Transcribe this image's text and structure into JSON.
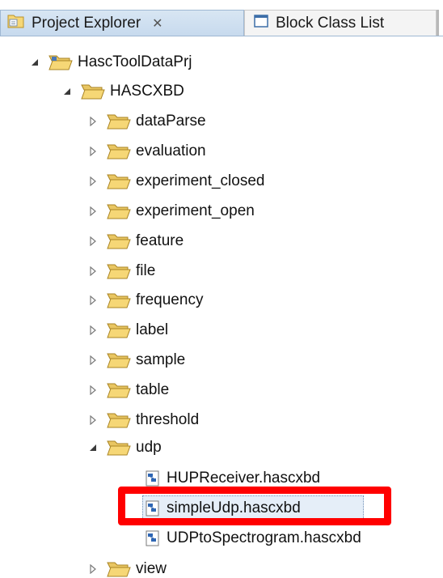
{
  "tabs": [
    {
      "label": "Project Explorer",
      "close_glyph": "✕",
      "icon": "project-explorer-icon",
      "active": true
    },
    {
      "label": "Block Class List",
      "icon": "block-class-list-icon",
      "active": false
    }
  ],
  "tree": {
    "root": {
      "label": "HascToolDataPrj",
      "expanded": true
    },
    "project_folder": {
      "label": "HASCXBD",
      "expanded": true
    },
    "folders": [
      {
        "label": "dataParse"
      },
      {
        "label": "evaluation"
      },
      {
        "label": "experiment_closed"
      },
      {
        "label": "experiment_open"
      },
      {
        "label": "feature"
      },
      {
        "label": "file"
      },
      {
        "label": "frequency"
      },
      {
        "label": "label"
      },
      {
        "label": "sample"
      },
      {
        "label": "table"
      },
      {
        "label": "threshold"
      }
    ],
    "udp_folder": {
      "label": "udp",
      "expanded": true
    },
    "udp_files": [
      {
        "label": "HUPReceiver.hascxbd",
        "selected": false
      },
      {
        "label": "simpleUdp.hascxbd",
        "selected": true
      },
      {
        "label": "UDPtoSpectrogram.hascxbd",
        "selected": false
      }
    ],
    "last_folder": {
      "label": "view"
    }
  },
  "colors": {
    "highlight": "#ff0000",
    "folder_fill": "#f6d776",
    "folder_stroke": "#b8922a",
    "tab_active": "#c7daee"
  }
}
